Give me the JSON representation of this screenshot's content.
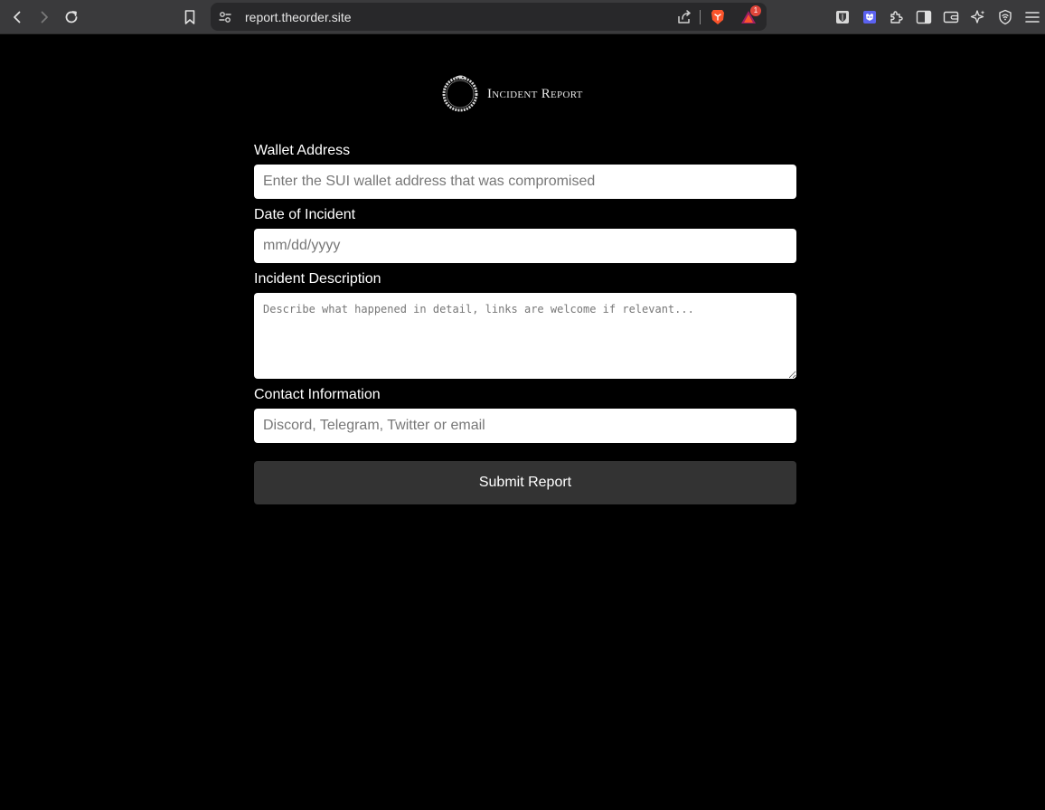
{
  "browser": {
    "url": "report.theorder.site",
    "notification_count": "1",
    "accent_color": "#fb542b"
  },
  "header": {
    "title": "Incident Report"
  },
  "form": {
    "wallet": {
      "label": "Wallet Address",
      "placeholder": "Enter the SUI wallet address that was compromised",
      "value": ""
    },
    "date": {
      "label": "Date of Incident",
      "placeholder": "mm/dd/yyyy",
      "value": ""
    },
    "description": {
      "label": "Incident Description",
      "placeholder": "Describe what happened in detail, links are welcome if relevant...",
      "value": ""
    },
    "contact": {
      "label": "Contact Information",
      "placeholder": "Discord, Telegram, Twitter or email",
      "value": ""
    },
    "submit_label": "Submit Report"
  },
  "colors": {
    "page_background": "#000000",
    "button_background": "#333333",
    "input_background": "#ffffff"
  }
}
